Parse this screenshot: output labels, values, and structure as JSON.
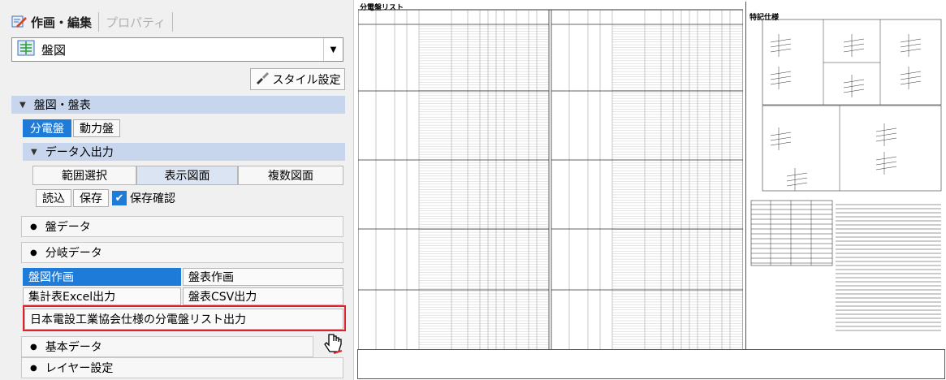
{
  "panel": {
    "tabs": [
      {
        "label": "作画・編集",
        "active": true
      },
      {
        "label": "プロパティ",
        "active": false
      }
    ],
    "style_select": {
      "value": "盤図"
    },
    "style_button": "スタイル設定",
    "section_board": {
      "title": "盤図・盤表",
      "seg": [
        {
          "label": "分電盤",
          "on": true
        },
        {
          "label": "動力盤",
          "on": false
        }
      ]
    },
    "section_io": {
      "title": "データ入出力",
      "row1": [
        "範囲選択",
        "表示図面",
        "複数図面"
      ],
      "row2": [
        "読込",
        "保存"
      ],
      "confirm_label": "保存確認"
    },
    "bullets": [
      {
        "label": "盤データ"
      },
      {
        "label": "分岐データ"
      }
    ],
    "commands": {
      "draw_board": "盤図作画",
      "draw_table": "盤表作画",
      "excel": "集計表Excel出力",
      "csv": "盤表CSV出力",
      "jeca": "日本電設工業協会仕様の分電盤リスト出力"
    },
    "bullets2": [
      {
        "label": "基本データ"
      },
      {
        "label": "レイヤー設定"
      }
    ]
  },
  "sheet1": {
    "title": "分電盤リスト"
  },
  "sheet2": {
    "title": "特記仕様"
  },
  "colors": {
    "accent": "#1e7bd7",
    "header_band": "#c7d6ec",
    "highlight": "#e0222c"
  }
}
